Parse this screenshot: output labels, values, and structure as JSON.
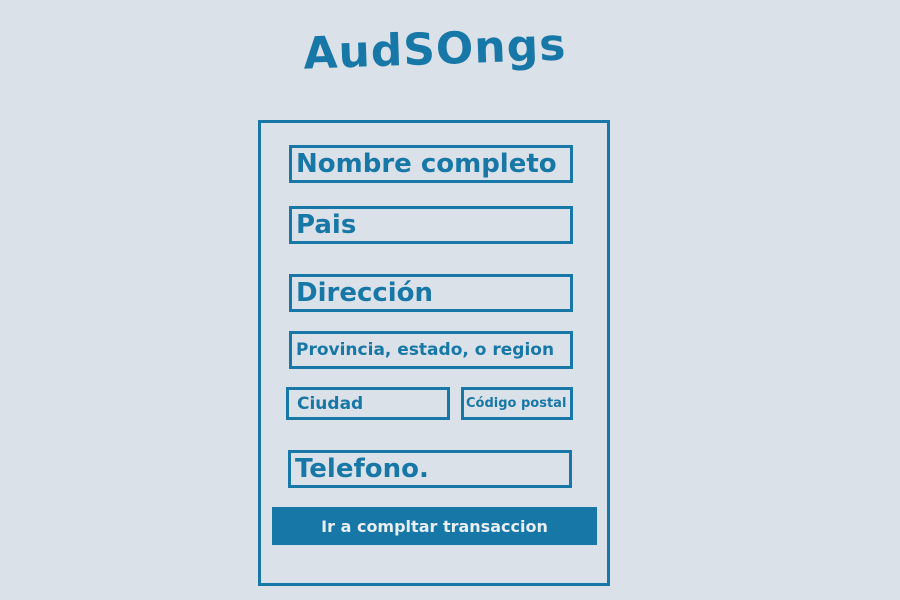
{
  "brand": {
    "logo_text": "AudSOngs"
  },
  "form": {
    "nombre": {
      "placeholder": "Nombre completo"
    },
    "pais": {
      "placeholder": "Pais"
    },
    "direccion": {
      "placeholder": "Dirección"
    },
    "provincia": {
      "placeholder": "Provincia, estado, o region"
    },
    "ciudad": {
      "placeholder": "Ciudad"
    },
    "codigo_postal": {
      "placeholder": "Código postal"
    },
    "telefono": {
      "placeholder": "Telefono."
    },
    "submit_label": "Ir a compltar transaccion"
  },
  "colors": {
    "background": "#dbe1e8",
    "accent": "#1777a6"
  }
}
